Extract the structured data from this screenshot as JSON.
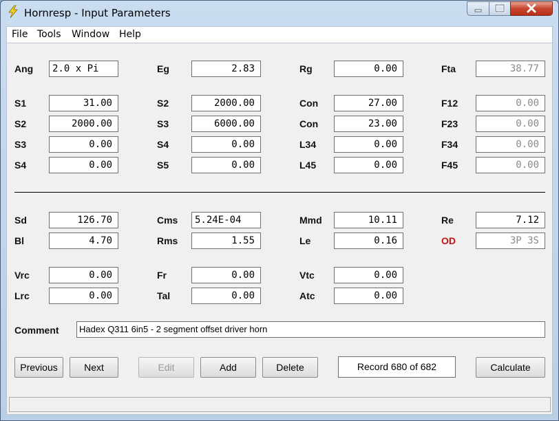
{
  "window": {
    "title": "Hornresp - Input Parameters"
  },
  "menu": {
    "file": "File",
    "tools": "Tools",
    "window": "Window",
    "help": "Help"
  },
  "params": {
    "ang": {
      "label": "Ang",
      "value": "2.0 x Pi"
    },
    "eg": {
      "label": "Eg",
      "value": "2.83"
    },
    "rg": {
      "label": "Rg",
      "value": "0.00"
    },
    "fta": {
      "label": "Fta",
      "value": "38.77"
    },
    "s1": {
      "label": "S1",
      "value": "31.00"
    },
    "s2a": {
      "label": "S2",
      "value": "2000.00"
    },
    "con1": {
      "label": "Con",
      "value": "27.00"
    },
    "f12": {
      "label": "F12",
      "value": "0.00"
    },
    "s2b": {
      "label": "S2",
      "value": "2000.00"
    },
    "s3a": {
      "label": "S3",
      "value": "6000.00"
    },
    "con2": {
      "label": "Con",
      "value": "23.00"
    },
    "f23": {
      "label": "F23",
      "value": "0.00"
    },
    "s3b": {
      "label": "S3",
      "value": "0.00"
    },
    "s4a": {
      "label": "S4",
      "value": "0.00"
    },
    "l34": {
      "label": "L34",
      "value": "0.00"
    },
    "f34": {
      "label": "F34",
      "value": "0.00"
    },
    "s4b": {
      "label": "S4",
      "value": "0.00"
    },
    "s5": {
      "label": "S5",
      "value": "0.00"
    },
    "l45": {
      "label": "L45",
      "value": "0.00"
    },
    "f45": {
      "label": "F45",
      "value": "0.00"
    },
    "sd": {
      "label": "Sd",
      "value": "126.70"
    },
    "cms": {
      "label": "Cms",
      "value": "5.24E-04"
    },
    "mmd": {
      "label": "Mmd",
      "value": "10.11"
    },
    "re": {
      "label": "Re",
      "value": "7.12"
    },
    "bl": {
      "label": "Bl",
      "value": "4.70"
    },
    "rms": {
      "label": "Rms",
      "value": "1.55"
    },
    "le": {
      "label": "Le",
      "value": "0.16"
    },
    "od": {
      "label": "OD",
      "value": "3P 3S"
    },
    "vrc": {
      "label": "Vrc",
      "value": "0.00"
    },
    "fr": {
      "label": "Fr",
      "value": "0.00"
    },
    "vtc": {
      "label": "Vtc",
      "value": "0.00"
    },
    "lrc": {
      "label": "Lrc",
      "value": "0.00"
    },
    "tal": {
      "label": "Tal",
      "value": "0.00"
    },
    "atc": {
      "label": "Atc",
      "value": "0.00"
    }
  },
  "comment": {
    "label": "Comment",
    "value": "Hadex Q311 6in5 - 2 segment offset driver horn"
  },
  "buttons": {
    "previous": "Previous",
    "next": "Next",
    "edit": "Edit",
    "add": "Add",
    "delete": "Delete",
    "calculate": "Calculate"
  },
  "record": "Record 680 of 682",
  "colors": {
    "od_label": "#cc1010",
    "readonly_text": "#8a8a8a"
  },
  "icons": {
    "app": "lightning-icon"
  }
}
